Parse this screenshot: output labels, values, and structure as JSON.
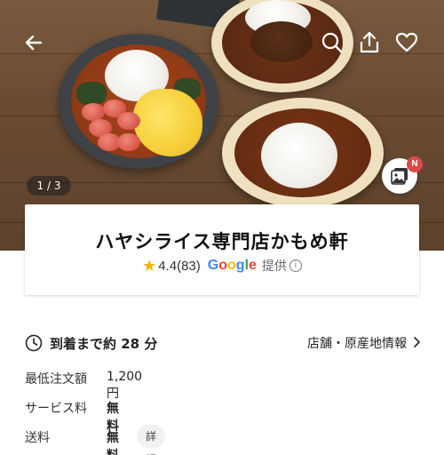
{
  "hero": {
    "pager": "1 / 3",
    "new_badge": "N"
  },
  "restaurant": {
    "name": "ハヤシライス専門店かもめ軒",
    "rating": "4.4",
    "review_count": "(83)",
    "provider_text": "提供"
  },
  "google_logo": [
    "G",
    "o",
    "o",
    "g",
    "l",
    "e"
  ],
  "delivery": {
    "eta_text": "到着まで約 28 分",
    "store_info_link": "店舗・原産地情報"
  },
  "details": [
    {
      "label": "最低注文額",
      "value": "1,200 円"
    },
    {
      "label": "サービス料",
      "value": "無料"
    },
    {
      "label": "送料",
      "value": "無料",
      "chip": "詳細"
    }
  ],
  "colors": {
    "star": "#f5b400",
    "badge": "#e04848",
    "google_blue": "#4285f4",
    "google_red": "#ea4335",
    "google_yellow": "#fbbc05",
    "google_green": "#34a853"
  },
  "icons": {
    "back": "arrow-left-icon",
    "search": "search-icon",
    "share": "share-icon",
    "favorite": "heart-icon",
    "gallery": "gallery-icon",
    "clock": "clock-icon",
    "chevron": "chevron-right-icon",
    "info": "info-icon",
    "star": "star-icon"
  }
}
